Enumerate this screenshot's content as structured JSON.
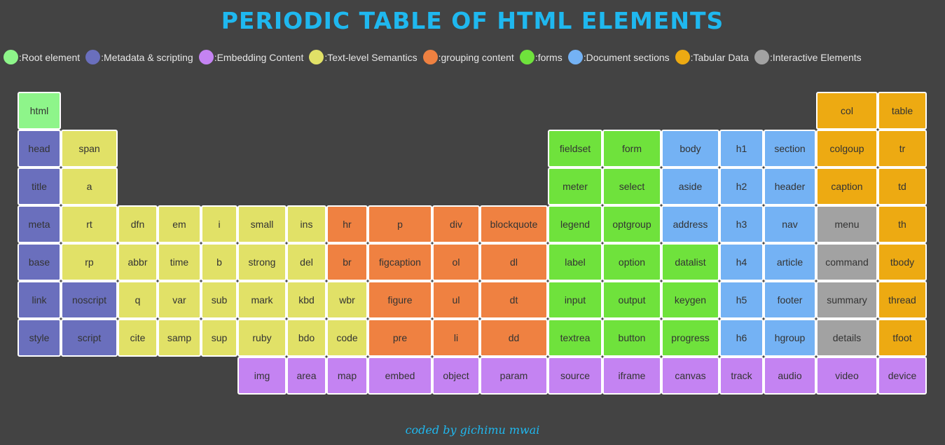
{
  "title": "PERIODIC TABLE OF HTML ELEMENTS",
  "footer": "coded by gichimu mwai",
  "colors": {
    "root": "#8ef58a",
    "meta": "#6a6fbd",
    "embed": "#c483f2",
    "text": "#e1e167",
    "group": "#ef8141",
    "forms": "#6fe23c",
    "sections": "#74b2f4",
    "tabular": "#edaa12",
    "interactive": "#a2a2a2"
  },
  "legend": [
    {
      "cat": "root",
      "label": ":Root element"
    },
    {
      "cat": "meta",
      "label": ":Metadata & scripting"
    },
    {
      "cat": "embed",
      "label": ":Embedding Content"
    },
    {
      "cat": "text",
      "label": ":Text-level Semantics"
    },
    {
      "cat": "group",
      "label": ":grouping content"
    },
    {
      "cat": "forms",
      "label": ":forms"
    },
    {
      "cat": "sections",
      "label": ":Document sections"
    },
    {
      "cat": "tabular",
      "label": ":Tabular Data"
    },
    {
      "cat": "interactive",
      "label": ":Interactive Elements"
    }
  ],
  "elements": [
    {
      "name": "html",
      "cat": "root",
      "col": 0,
      "row": 0
    },
    {
      "name": "head",
      "cat": "meta",
      "col": 0,
      "row": 1
    },
    {
      "name": "title",
      "cat": "meta",
      "col": 0,
      "row": 2
    },
    {
      "name": "meta",
      "cat": "meta",
      "col": 0,
      "row": 3
    },
    {
      "name": "base",
      "cat": "meta",
      "col": 0,
      "row": 4
    },
    {
      "name": "link",
      "cat": "meta",
      "col": 0,
      "row": 5
    },
    {
      "name": "style",
      "cat": "meta",
      "col": 0,
      "row": 6
    },
    {
      "name": "span",
      "cat": "text",
      "col": 1,
      "row": 1
    },
    {
      "name": "a",
      "cat": "text",
      "col": 1,
      "row": 2
    },
    {
      "name": "rt",
      "cat": "text",
      "col": 1,
      "row": 3
    },
    {
      "name": "rp",
      "cat": "text",
      "col": 1,
      "row": 4
    },
    {
      "name": "noscript",
      "cat": "meta",
      "col": 1,
      "row": 5
    },
    {
      "name": "script",
      "cat": "meta",
      "col": 1,
      "row": 6
    },
    {
      "name": "dfn",
      "cat": "text",
      "col": 2,
      "row": 3
    },
    {
      "name": "abbr",
      "cat": "text",
      "col": 2,
      "row": 4
    },
    {
      "name": "q",
      "cat": "text",
      "col": 2,
      "row": 5
    },
    {
      "name": "cite",
      "cat": "text",
      "col": 2,
      "row": 6
    },
    {
      "name": "em",
      "cat": "text",
      "col": 3,
      "row": 3
    },
    {
      "name": "time",
      "cat": "text",
      "col": 3,
      "row": 4
    },
    {
      "name": "var",
      "cat": "text",
      "col": 3,
      "row": 5
    },
    {
      "name": "samp",
      "cat": "text",
      "col": 3,
      "row": 6
    },
    {
      "name": "i",
      "cat": "text",
      "col": 4,
      "row": 3
    },
    {
      "name": "b",
      "cat": "text",
      "col": 4,
      "row": 4
    },
    {
      "name": "sub",
      "cat": "text",
      "col": 4,
      "row": 5
    },
    {
      "name": "sup",
      "cat": "text",
      "col": 4,
      "row": 6
    },
    {
      "name": "small",
      "cat": "text",
      "col": 5,
      "row": 3
    },
    {
      "name": "strong",
      "cat": "text",
      "col": 5,
      "row": 4
    },
    {
      "name": "mark",
      "cat": "text",
      "col": 5,
      "row": 5
    },
    {
      "name": "ruby",
      "cat": "text",
      "col": 5,
      "row": 6
    },
    {
      "name": "img",
      "cat": "embed",
      "col": 5,
      "row": 7
    },
    {
      "name": "ins",
      "cat": "text",
      "col": 6,
      "row": 3
    },
    {
      "name": "del",
      "cat": "text",
      "col": 6,
      "row": 4
    },
    {
      "name": "kbd",
      "cat": "text",
      "col": 6,
      "row": 5
    },
    {
      "name": "bdo",
      "cat": "text",
      "col": 6,
      "row": 6
    },
    {
      "name": "area",
      "cat": "embed",
      "col": 6,
      "row": 7
    },
    {
      "name": "hr",
      "cat": "group",
      "col": 7,
      "row": 3
    },
    {
      "name": "br",
      "cat": "group",
      "col": 7,
      "row": 4
    },
    {
      "name": "wbr",
      "cat": "text",
      "col": 7,
      "row": 5
    },
    {
      "name": "code",
      "cat": "text",
      "col": 7,
      "row": 6
    },
    {
      "name": "map",
      "cat": "embed",
      "col": 7,
      "row": 7
    },
    {
      "name": "p",
      "cat": "group",
      "col": 8,
      "row": 3
    },
    {
      "name": "figcaption",
      "cat": "group",
      "col": 8,
      "row": 4
    },
    {
      "name": "figure",
      "cat": "group",
      "col": 8,
      "row": 5
    },
    {
      "name": "pre",
      "cat": "group",
      "col": 8,
      "row": 6
    },
    {
      "name": "embed",
      "cat": "embed",
      "col": 8,
      "row": 7
    },
    {
      "name": "div",
      "cat": "group",
      "col": 9,
      "row": 3
    },
    {
      "name": "ol",
      "cat": "group",
      "col": 9,
      "row": 4
    },
    {
      "name": "ul",
      "cat": "group",
      "col": 9,
      "row": 5
    },
    {
      "name": "li",
      "cat": "group",
      "col": 9,
      "row": 6
    },
    {
      "name": "object",
      "cat": "embed",
      "col": 9,
      "row": 7
    },
    {
      "name": "blockquote",
      "cat": "group",
      "col": 10,
      "row": 3
    },
    {
      "name": "dl",
      "cat": "group",
      "col": 10,
      "row": 4
    },
    {
      "name": "dt",
      "cat": "group",
      "col": 10,
      "row": 5
    },
    {
      "name": "dd",
      "cat": "group",
      "col": 10,
      "row": 6
    },
    {
      "name": "param",
      "cat": "embed",
      "col": 10,
      "row": 7
    },
    {
      "name": "fieldset",
      "cat": "forms",
      "col": 11,
      "row": 1
    },
    {
      "name": "meter",
      "cat": "forms",
      "col": 11,
      "row": 2
    },
    {
      "name": "legend",
      "cat": "forms",
      "col": 11,
      "row": 3
    },
    {
      "name": "label",
      "cat": "forms",
      "col": 11,
      "row": 4
    },
    {
      "name": "input",
      "cat": "forms",
      "col": 11,
      "row": 5
    },
    {
      "name": "textrea",
      "cat": "forms",
      "col": 11,
      "row": 6
    },
    {
      "name": "source",
      "cat": "embed",
      "col": 11,
      "row": 7
    },
    {
      "name": "form",
      "cat": "forms",
      "col": 12,
      "row": 1
    },
    {
      "name": "select",
      "cat": "forms",
      "col": 12,
      "row": 2
    },
    {
      "name": "optgroup",
      "cat": "forms",
      "col": 12,
      "row": 3
    },
    {
      "name": "option",
      "cat": "forms",
      "col": 12,
      "row": 4
    },
    {
      "name": "output",
      "cat": "forms",
      "col": 12,
      "row": 5
    },
    {
      "name": "button",
      "cat": "forms",
      "col": 12,
      "row": 6
    },
    {
      "name": "iframe",
      "cat": "embed",
      "col": 12,
      "row": 7
    },
    {
      "name": "body",
      "cat": "sections",
      "col": 13,
      "row": 1
    },
    {
      "name": "aside",
      "cat": "sections",
      "col": 13,
      "row": 2
    },
    {
      "name": "address",
      "cat": "sections",
      "col": 13,
      "row": 3
    },
    {
      "name": "datalist",
      "cat": "forms",
      "col": 13,
      "row": 4
    },
    {
      "name": "keygen",
      "cat": "forms",
      "col": 13,
      "row": 5
    },
    {
      "name": "progress",
      "cat": "forms",
      "col": 13,
      "row": 6
    },
    {
      "name": "canvas",
      "cat": "embed",
      "col": 13,
      "row": 7
    },
    {
      "name": "h1",
      "cat": "sections",
      "col": 14,
      "row": 1
    },
    {
      "name": "h2",
      "cat": "sections",
      "col": 14,
      "row": 2
    },
    {
      "name": "h3",
      "cat": "sections",
      "col": 14,
      "row": 3
    },
    {
      "name": "h4",
      "cat": "sections",
      "col": 14,
      "row": 4
    },
    {
      "name": "h5",
      "cat": "sections",
      "col": 14,
      "row": 5
    },
    {
      "name": "h6",
      "cat": "sections",
      "col": 14,
      "row": 6
    },
    {
      "name": "track",
      "cat": "embed",
      "col": 14,
      "row": 7
    },
    {
      "name": "section",
      "cat": "sections",
      "col": 15,
      "row": 1
    },
    {
      "name": "header",
      "cat": "sections",
      "col": 15,
      "row": 2
    },
    {
      "name": "nav",
      "cat": "sections",
      "col": 15,
      "row": 3
    },
    {
      "name": "article",
      "cat": "sections",
      "col": 15,
      "row": 4
    },
    {
      "name": "footer",
      "cat": "sections",
      "col": 15,
      "row": 5
    },
    {
      "name": "hgroup",
      "cat": "sections",
      "col": 15,
      "row": 6
    },
    {
      "name": "audio",
      "cat": "embed",
      "col": 15,
      "row": 7
    },
    {
      "name": "col",
      "cat": "tabular",
      "col": 16,
      "row": 0
    },
    {
      "name": "colgoup",
      "cat": "tabular",
      "col": 16,
      "row": 1
    },
    {
      "name": "caption",
      "cat": "tabular",
      "col": 16,
      "row": 2
    },
    {
      "name": "menu",
      "cat": "interactive",
      "col": 16,
      "row": 3
    },
    {
      "name": "command",
      "cat": "interactive",
      "col": 16,
      "row": 4
    },
    {
      "name": "summary",
      "cat": "interactive",
      "col": 16,
      "row": 5
    },
    {
      "name": "details",
      "cat": "interactive",
      "col": 16,
      "row": 6
    },
    {
      "name": "video",
      "cat": "embed",
      "col": 16,
      "row": 7
    },
    {
      "name": "table",
      "cat": "tabular",
      "col": 17,
      "row": 0
    },
    {
      "name": "tr",
      "cat": "tabular",
      "col": 17,
      "row": 1
    },
    {
      "name": "td",
      "cat": "tabular",
      "col": 17,
      "row": 2
    },
    {
      "name": "th",
      "cat": "tabular",
      "col": 17,
      "row": 3
    },
    {
      "name": "tbody",
      "cat": "tabular",
      "col": 17,
      "row": 4
    },
    {
      "name": "thread",
      "cat": "tabular",
      "col": 17,
      "row": 5
    },
    {
      "name": "tfoot",
      "cat": "tabular",
      "col": 17,
      "row": 6
    },
    {
      "name": "device",
      "cat": "embed",
      "col": 17,
      "row": 7
    }
  ]
}
